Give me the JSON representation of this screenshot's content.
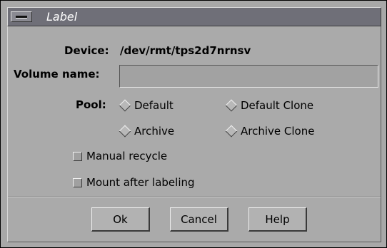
{
  "window": {
    "title": "Label",
    "menu_icon": "window-menu-icon"
  },
  "device": {
    "label": "Device:",
    "value": "/dev/rmt/tps2d7nrnsv"
  },
  "volume": {
    "label": "Volume name:",
    "value": ""
  },
  "pool": {
    "label": "Pool:",
    "options": [
      "Default",
      "Default Clone",
      "Archive",
      "Archive Clone"
    ]
  },
  "options": {
    "manual_recycle": "Manual recycle",
    "mount_after_labeling": "Mount after labeling"
  },
  "buttons": {
    "ok": "Ok",
    "cancel": "Cancel",
    "help": "Help"
  }
}
